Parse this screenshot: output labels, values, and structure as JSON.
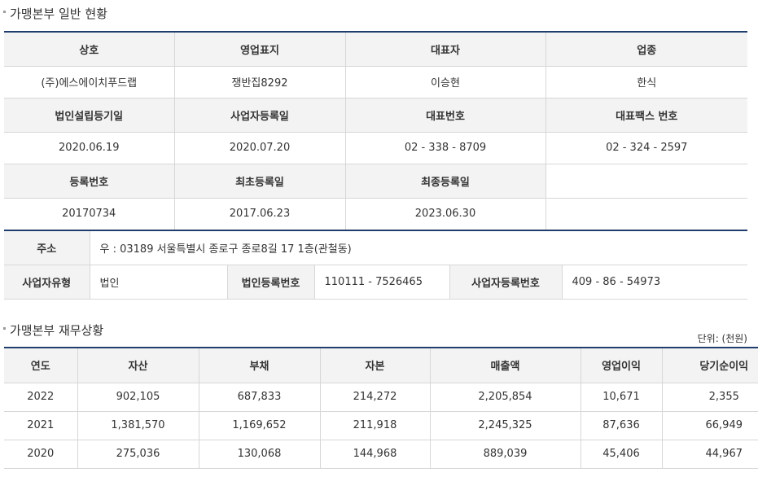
{
  "general": {
    "title": "가맹본부 일반 현황",
    "headers1": [
      "상호",
      "영업표지",
      "대표자",
      "업종"
    ],
    "values1": [
      "(주)에스에이치푸드랩",
      "쟁반집8292",
      "이승현",
      "한식"
    ],
    "headers2": [
      "법인설립등기일",
      "사업자등록일",
      "대표번호",
      "대표팩스 번호"
    ],
    "values2": [
      "2020.06.19",
      "2020.07.20",
      "02 - 338 - 8709",
      "02 - 324 - 2597"
    ],
    "headers3": [
      "등록번호",
      "최초등록일",
      "최종등록일",
      ""
    ],
    "values3": [
      "20170734",
      "2017.06.23",
      "2023.06.30",
      ""
    ]
  },
  "address": {
    "label": "주소",
    "value": "우 : 03189 서울특별시 종로구 종로8길 17 1층(관철동)",
    "biz_type_label": "사업자유형",
    "biz_type_value": "법인",
    "corp_reg_label": "법인등록번호",
    "corp_reg_value": "110111 - 7526465",
    "biz_reg_label": "사업자등록번호",
    "biz_reg_value": "409 - 86 - 54973"
  },
  "finance": {
    "title": "가맹본부 재무상황",
    "unit": "단위: (천원)",
    "headers": [
      "연도",
      "자산",
      "부채",
      "자본",
      "매출액",
      "영업이익",
      "당기순이익"
    ],
    "rows": [
      [
        "2022",
        "902,105",
        "687,833",
        "214,272",
        "2,205,854",
        "10,671",
        "2,355"
      ],
      [
        "2021",
        "1,381,570",
        "1,169,652",
        "211,918",
        "2,245,325",
        "87,636",
        "66,949"
      ],
      [
        "2020",
        "275,036",
        "130,068",
        "144,968",
        "889,039",
        "45,406",
        "44,967"
      ]
    ]
  }
}
